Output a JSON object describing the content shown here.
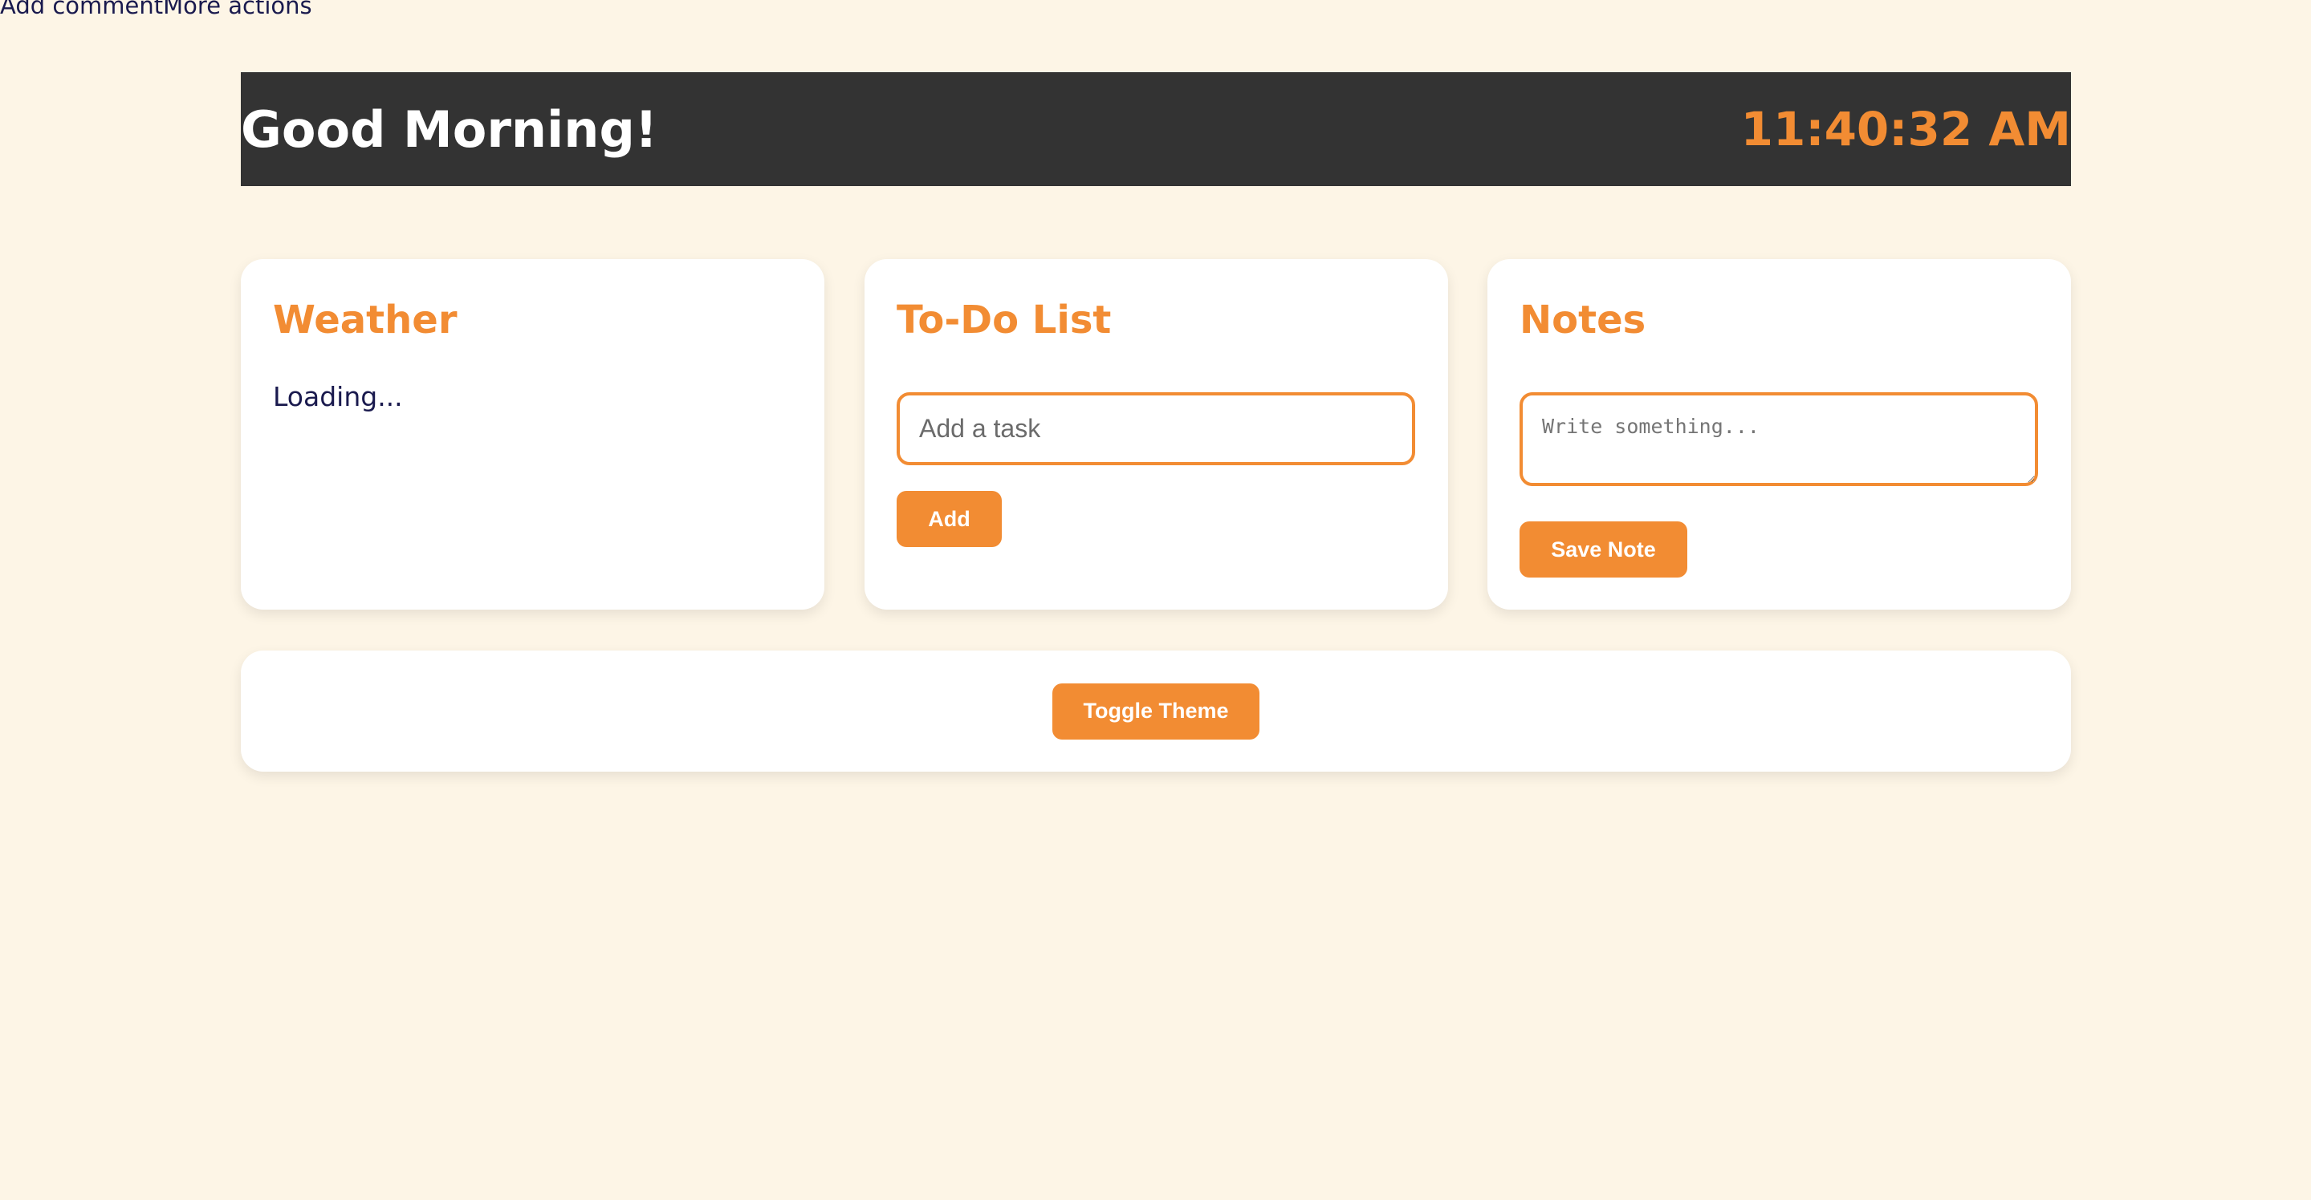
{
  "top_links": {
    "add_comment": "Add comment",
    "more_actions": "More actions"
  },
  "header": {
    "greeting": "Good Morning!",
    "time": "11:40:32 AM"
  },
  "weather": {
    "title": "Weather",
    "status": "Loading..."
  },
  "todo": {
    "title": "To-Do List",
    "input_placeholder": "Add a task",
    "add_label": "Add"
  },
  "notes": {
    "title": "Notes",
    "textarea_placeholder": "Write something...",
    "save_label": "Save Note"
  },
  "footer": {
    "toggle_label": "Toggle Theme"
  },
  "colors": {
    "background": "#fdf5e6",
    "header_bg": "#333333",
    "accent": "#f28c33",
    "text": "#1a1a4e"
  }
}
